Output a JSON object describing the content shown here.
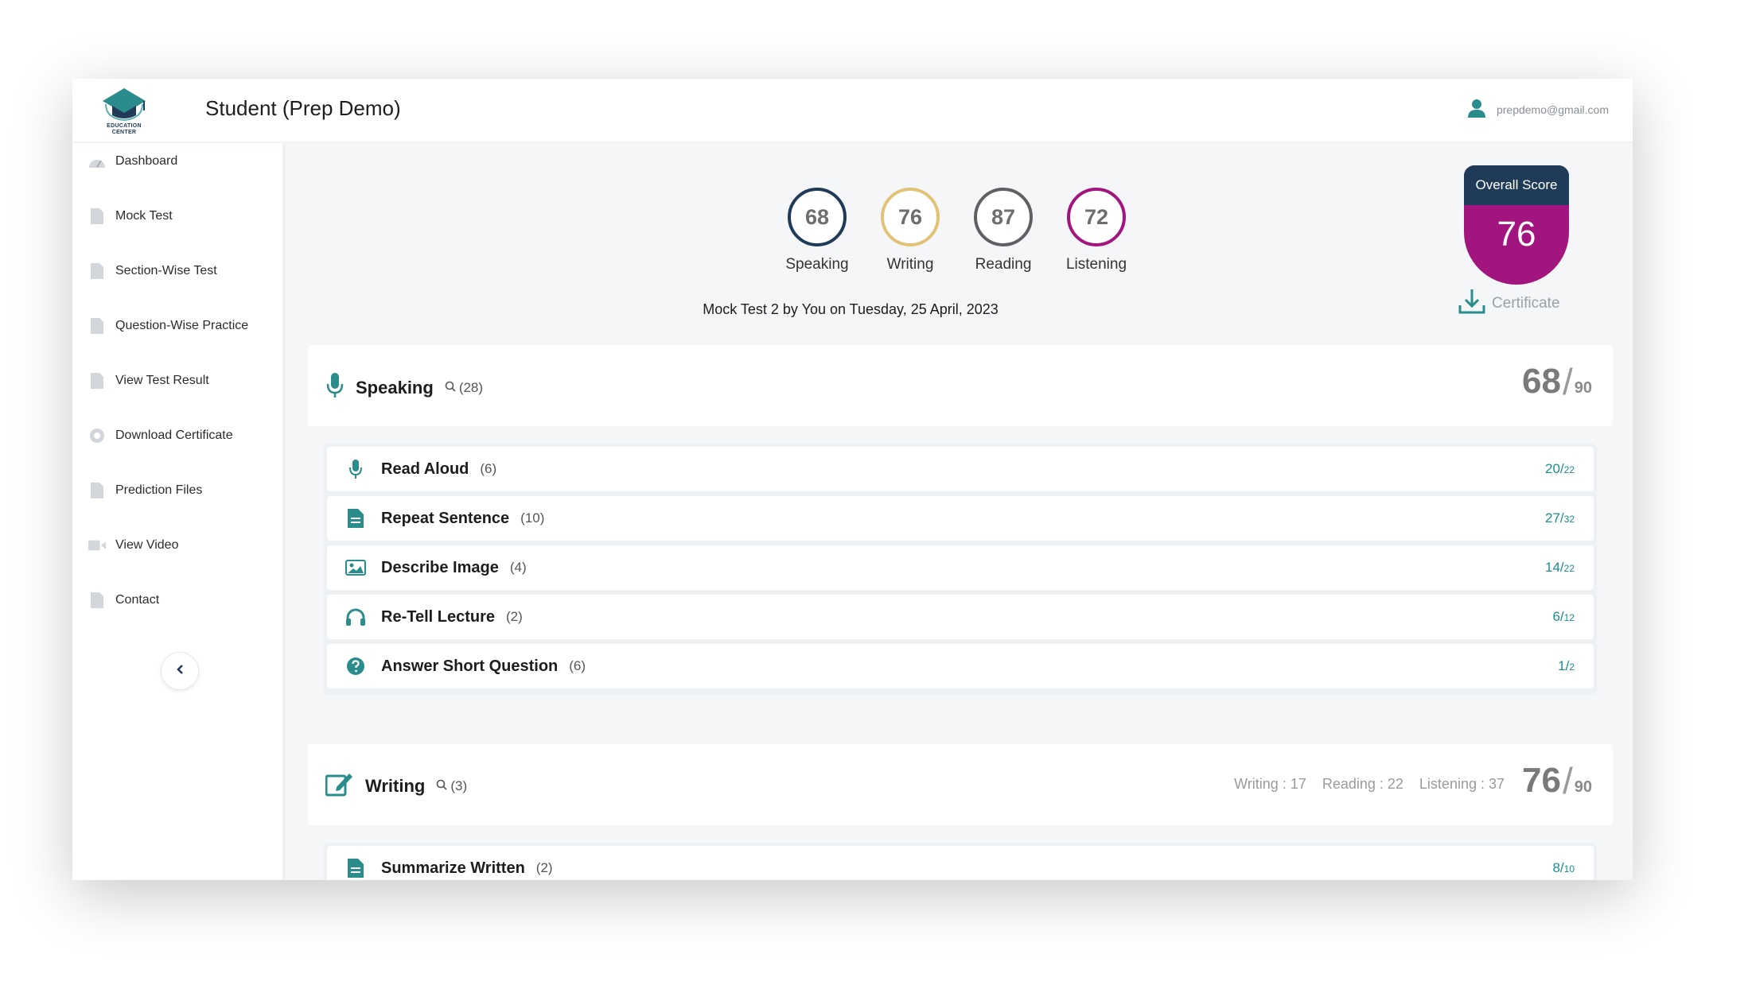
{
  "header": {
    "logo_caption_line1": "EDUCATION",
    "logo_caption_line2": "CENTER",
    "title": "Student (Prep Demo)",
    "user_email": "prepdemo@gmail.com"
  },
  "sidebar": {
    "items": [
      {
        "label": "Dashboard",
        "icon": "dashboard-icon"
      },
      {
        "label": "Mock Test",
        "icon": "document-icon"
      },
      {
        "label": "Section-Wise Test",
        "icon": "document-icon"
      },
      {
        "label": "Question-Wise Practice",
        "icon": "document-icon"
      },
      {
        "label": "View Test Result",
        "icon": "document-icon"
      },
      {
        "label": "Download Certificate",
        "icon": "certificate-icon"
      },
      {
        "label": "Prediction Files",
        "icon": "document-icon"
      },
      {
        "label": "View Video",
        "icon": "video-icon"
      },
      {
        "label": "Contact",
        "icon": "document-icon"
      }
    ]
  },
  "scores": [
    {
      "value": "68",
      "label": "Speaking",
      "color": "#1f3b57"
    },
    {
      "value": "76",
      "label": "Writing",
      "color": "#e2c277"
    },
    {
      "value": "87",
      "label": "Reading",
      "color": "#5f6064"
    },
    {
      "value": "72",
      "label": "Listening",
      "color": "#a3157e"
    }
  ],
  "test_info": "Mock Test 2 by You on Tuesday, 25 April, 2023",
  "overall": {
    "label": "Overall Score",
    "value": "76",
    "certificate_label": "Certificate"
  },
  "speaking": {
    "title": "Speaking",
    "count": "(28)",
    "score": "68",
    "out_of": "90",
    "rows": [
      {
        "name": "Read Aloud",
        "count": "(6)",
        "score": "20",
        "out_of": "22"
      },
      {
        "name": "Repeat Sentence",
        "count": "(10)",
        "score": "27",
        "out_of": "32"
      },
      {
        "name": "Describe Image",
        "count": "(4)",
        "score": "14",
        "out_of": "22"
      },
      {
        "name": "Re-Tell Lecture",
        "count": "(2)",
        "score": "6",
        "out_of": "12"
      },
      {
        "name": "Answer Short Question",
        "count": "(6)",
        "score": "1",
        "out_of": "2"
      }
    ]
  },
  "writing": {
    "title": "Writing",
    "count": "(3)",
    "breakdown": [
      "Writing : 17",
      "Reading : 22",
      "Listening : 37"
    ],
    "score": "76",
    "out_of": "90",
    "rows": [
      {
        "name": "Summarize Written",
        "count": "(2)",
        "score": "8",
        "out_of": "10"
      }
    ]
  },
  "colors": {
    "navy": "#1f3b57",
    "teal": "#1a8e8e",
    "magenta": "#a3157e",
    "gold": "#e2c277"
  }
}
